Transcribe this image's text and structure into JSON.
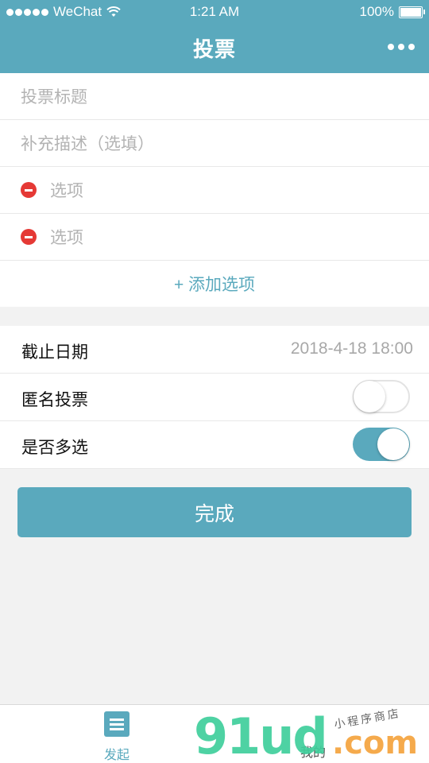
{
  "status_bar": {
    "carrier": "WeChat",
    "time": "1:21 AM",
    "battery": "100%"
  },
  "nav": {
    "title": "投票",
    "more_icon": "more-dots-icon"
  },
  "form": {
    "title_placeholder": "投票标题",
    "description_placeholder": "补充描述（选填）",
    "options": [
      {
        "placeholder": "选项"
      },
      {
        "placeholder": "选项"
      }
    ],
    "add_option_label": "+ 添加选项"
  },
  "settings": {
    "deadline_label": "截止日期",
    "deadline_value": "2018-4-18 18:00",
    "anonymous_label": "匿名投票",
    "anonymous_on": false,
    "multiple_label": "是否多选",
    "multiple_on": true
  },
  "done_button_label": "完成",
  "tabbar": {
    "launch_label": "发起",
    "mine_label": "我的"
  },
  "watermark": {
    "main": "91ud",
    "domain": ".com",
    "sub": "小程序商店"
  },
  "colors": {
    "accent": "#5aa9bd",
    "remove_red": "#e53935",
    "background": "#f2f2f2"
  }
}
